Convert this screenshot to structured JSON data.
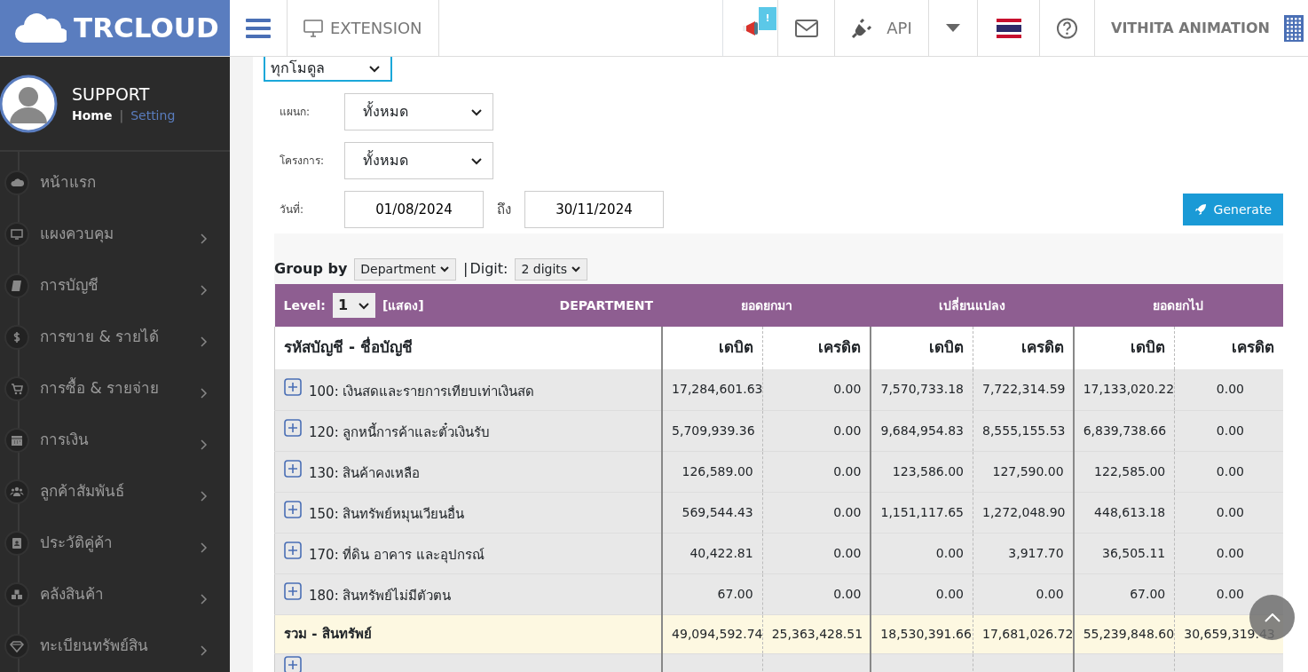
{
  "header": {
    "logo": "TRCLOUD",
    "extension": "EXTENSION",
    "notification_badge": "!",
    "api": "API",
    "company": "VITHITA ANIMATION"
  },
  "sidebar": {
    "user": "SUPPORT",
    "link_separator": "|",
    "links": [
      {
        "label": "Home",
        "selected": true
      },
      {
        "label": "Setting",
        "selected": false
      }
    ],
    "items": [
      {
        "label": "หน้าแรก",
        "has_submenu": false
      },
      {
        "label": "แผงควบคุม",
        "has_submenu": true
      },
      {
        "label": "การบัญชี",
        "has_submenu": true
      },
      {
        "label": "การขาย & รายได้",
        "has_submenu": true
      },
      {
        "label": "การซื้อ & รายจ่าย",
        "has_submenu": true
      },
      {
        "label": "การเงิน",
        "has_submenu": true
      },
      {
        "label": "ลูกค้าสัมพันธ์",
        "has_submenu": true
      },
      {
        "label": "ประวัติคู่ค้า",
        "has_submenu": true
      },
      {
        "label": "คลังสินค้า",
        "has_submenu": true
      },
      {
        "label": "ทะเบียนทรัพย์สิน",
        "has_submenu": true
      }
    ]
  },
  "filters": {
    "module": "ทุกโมดูล",
    "department_label": "แผนก:",
    "department": "ทั้งหมด",
    "project_label": "โครงการ:",
    "project": "ทั้งหมด",
    "date_label": "วันที่:",
    "date_from": "01/08/2024",
    "to_label": "ถึง",
    "date_to": "30/11/2024",
    "generate": "Generate"
  },
  "report": {
    "group_by_label": "Group by",
    "group_by": "Department",
    "separator": "|",
    "digit_label": "Digit:",
    "digit": "2 digits",
    "level_label": "Level:",
    "level": "1",
    "show": "[แสดง]",
    "dimension": "DEPARTMENT",
    "groups": [
      "ยอดยกมา",
      "เปลี่ยนแปลง",
      "ยอดยกไป"
    ],
    "columns": [
      "รหัสบัญชี - ชื่อบัญชี",
      "เดบิต",
      "เครดิต",
      "เดบิต",
      "เครดิต",
      "เดบิต",
      "เครดิต"
    ],
    "rows": [
      {
        "kind": "account",
        "label": "100: เงินสดและรายการเทียบเท่าเงินสด",
        "values": [
          "17,284,601.63",
          "0.00",
          "7,570,733.18",
          "7,722,314.59",
          "17,133,020.22",
          "0.00"
        ]
      },
      {
        "kind": "account",
        "label": "120: ลูกหนี้การค้าและตั๋วเงินรับ",
        "values": [
          "5,709,939.36",
          "0.00",
          "9,684,954.83",
          "8,555,155.53",
          "6,839,738.66",
          "0.00"
        ]
      },
      {
        "kind": "account",
        "label": "130: สินค้าคงเหลือ",
        "values": [
          "126,589.00",
          "0.00",
          "123,586.00",
          "127,590.00",
          "122,585.00",
          "0.00"
        ]
      },
      {
        "kind": "account",
        "label": "150: สินทรัพย์หมุนเวียนอื่น",
        "values": [
          "569,544.43",
          "0.00",
          "1,151,117.65",
          "1,272,048.90",
          "448,613.18",
          "0.00"
        ]
      },
      {
        "kind": "account",
        "label": "170: ที่ดิน อาคาร และอุปกรณ์",
        "values": [
          "40,422.81",
          "0.00",
          "0.00",
          "3,917.70",
          "36,505.11",
          "0.00"
        ]
      },
      {
        "kind": "account",
        "label": "180: สินทรัพย์ไม่มีตัวตน",
        "values": [
          "67.00",
          "0.00",
          "0.00",
          "0.00",
          "67.00",
          "0.00"
        ]
      },
      {
        "kind": "total",
        "label": "รวม - สินทรัพย์",
        "values": [
          "49,094,592.74",
          "25,363,428.51",
          "18,530,391.66",
          "17,681,026.72",
          "55,239,848.60",
          "30,659,319.43"
        ]
      },
      {
        "kind": "account"
      }
    ]
  }
}
